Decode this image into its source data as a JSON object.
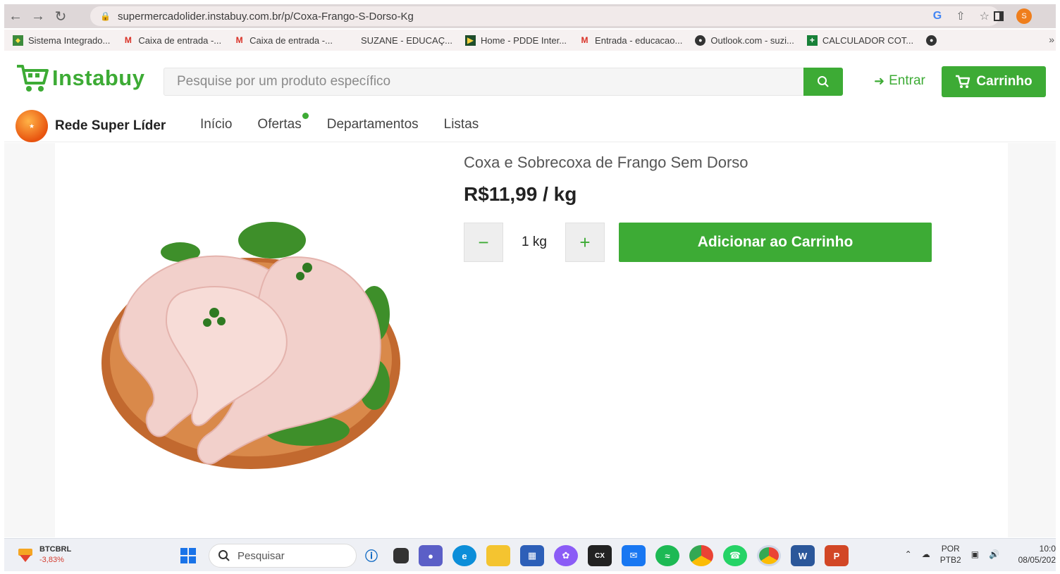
{
  "browser": {
    "url": "supermercadolider.instabuy.com.br/p/Coxa-Frango-S-Dorso-Kg",
    "profile_initial": "S"
  },
  "bookmarks": [
    {
      "label": "Sistema Integrado...",
      "icon": "flag-icon"
    },
    {
      "label": "Caixa de entrada -...",
      "icon": "gmail-icon"
    },
    {
      "label": "Caixa de entrada -...",
      "icon": "gmail-icon"
    },
    {
      "label": "SUZANE - EDUCAÇ...",
      "icon": "microsoft-icon"
    },
    {
      "label": "Home - PDDE Inter...",
      "icon": "pdde-icon"
    },
    {
      "label": "Entrada - educacao...",
      "icon": "gmail-icon"
    },
    {
      "label": "Outlook.com - suzi...",
      "icon": "globe-icon"
    },
    {
      "label": "CALCULADOR COT...",
      "icon": "sheets-icon"
    }
  ],
  "site": {
    "logo_text": "Instabuy",
    "search_placeholder": "Pesquise por um produto específico",
    "login_label": "Entrar",
    "cart_label": "Carrinho",
    "store_name": "Rede Super Líder",
    "menu": [
      {
        "label": "Início"
      },
      {
        "label": "Ofertas"
      },
      {
        "label": "Departamentos"
      },
      {
        "label": "Listas"
      }
    ],
    "accent_color": "#3dab35"
  },
  "product": {
    "title": "Coxa e Sobrecoxa de Frango Sem Dorso",
    "price": "R$11,99 / kg",
    "quantity": "1 kg",
    "add_button": "Adicionar ao Carrinho"
  },
  "taskbar": {
    "ticker_name": "BTCBRL",
    "ticker_change": "-3,83%",
    "search_label": "Pesquisar",
    "lang_top": "POR",
    "lang_bottom": "PTB2",
    "time": "10:0",
    "date": "08/05/202"
  }
}
